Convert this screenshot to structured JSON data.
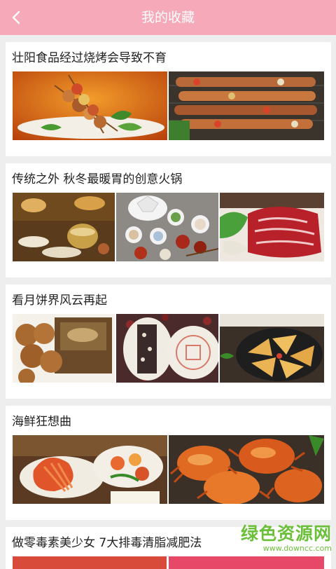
{
  "header": {
    "title": "我的收藏",
    "back_icon": "chevron-left-icon"
  },
  "colors": {
    "header_bg": "#f6a9b8",
    "page_bg": "#eeeeee",
    "card_bg": "#ffffff",
    "watermark": "#6cbf3a"
  },
  "favorites": [
    {
      "title": "壮阳食品经过烧烤会导致不育",
      "images": [
        "kebab-plate-photo",
        "grill-skewers-photo"
      ]
    },
    {
      "title": "传统之外 秋冬最暖胃的创意火锅",
      "images": [
        "hotpot-buffet-photo",
        "hotpot-dishes-photo",
        "sliced-beef-photo"
      ]
    },
    {
      "title": "看月饼界风云再起",
      "images": [
        "mooncakes-box-photo",
        "mooncake-cut-photo",
        "mooncake-slices-photo"
      ]
    },
    {
      "title": "海鲜狂想曲",
      "images": [
        "seafood-platter-photo",
        "steamed-crabs-photo"
      ]
    },
    {
      "title": "做零毒素美少女 7大排毒清脂减肥法",
      "images": []
    }
  ],
  "watermark": {
    "main": "绿色资源网",
    "sub": "www.downcc.com"
  }
}
